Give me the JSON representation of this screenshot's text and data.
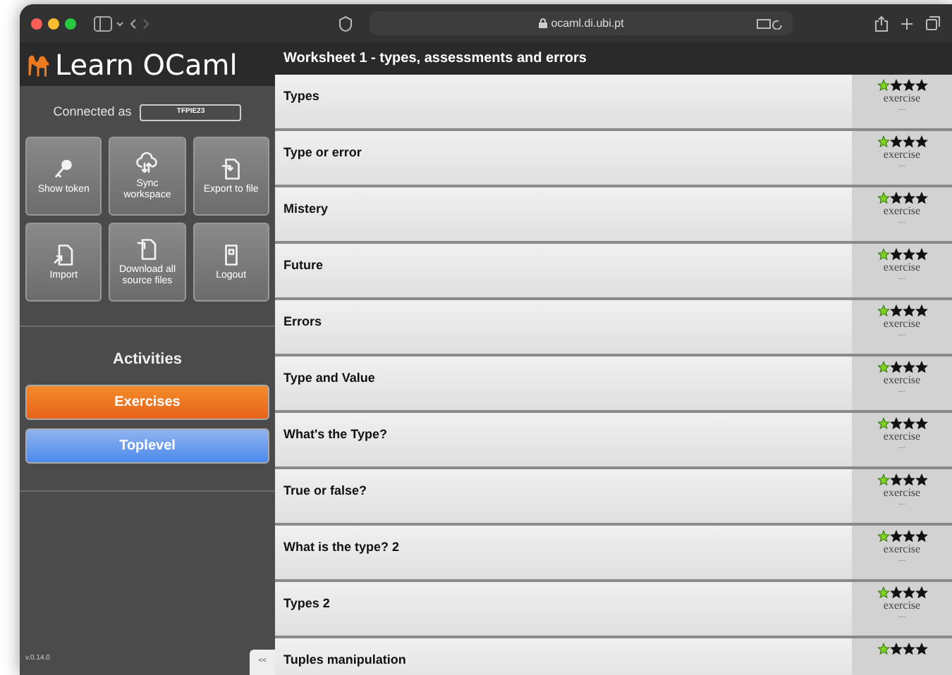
{
  "browser": {
    "address": "ocaml.di.ubi.pt"
  },
  "sidebar": {
    "title": "Learn OCaml",
    "connected_label": "Connected as",
    "token": "TFPIE23",
    "actions": [
      {
        "label": "Show token",
        "kind": "key"
      },
      {
        "label": "Sync workspace",
        "kind": "sync"
      },
      {
        "label": "Export to file",
        "kind": "export"
      },
      {
        "label": "Import",
        "kind": "import"
      },
      {
        "label": "Download all source files",
        "kind": "download"
      },
      {
        "label": "Logout",
        "kind": "logout"
      }
    ],
    "activities_title": "Activities",
    "activities": [
      {
        "label": "Exercises",
        "selected": true
      },
      {
        "label": "Toplevel",
        "selected": false
      }
    ],
    "version": "v.0.14.0",
    "collapse": "<<"
  },
  "main": {
    "title": "Worksheet 1 - types, assessments and errors",
    "exercises": [
      {
        "title": "Types",
        "stars": 1,
        "kind": "exercise",
        "score": "---"
      },
      {
        "title": "Type or error",
        "stars": 1,
        "kind": "exercise",
        "score": "---"
      },
      {
        "title": "Mistery",
        "stars": 1,
        "kind": "exercise",
        "score": "---"
      },
      {
        "title": "Future",
        "stars": 1,
        "kind": "exercise",
        "score": "---"
      },
      {
        "title": "Errors",
        "stars": 1,
        "kind": "exercise",
        "score": "---"
      },
      {
        "title": "Type and Value",
        "stars": 1,
        "kind": "exercise",
        "score": "---"
      },
      {
        "title": "What's the Type?",
        "stars": 1,
        "kind": "exercise",
        "score": "---"
      },
      {
        "title": "True or false?",
        "stars": 1,
        "kind": "exercise",
        "score": "---"
      },
      {
        "title": "What is the type? 2",
        "stars": 1,
        "kind": "exercise",
        "score": "---"
      },
      {
        "title": "Types 2",
        "stars": 1,
        "kind": "exercise",
        "score": "---"
      },
      {
        "title": "Tuples manipulation",
        "stars": 1
      }
    ]
  }
}
